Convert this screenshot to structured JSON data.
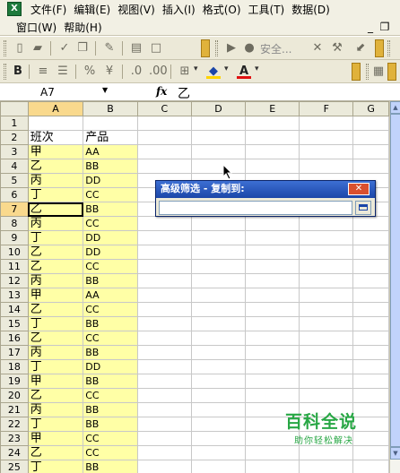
{
  "menu": {
    "row1": [
      "文件(F)",
      "编辑(E)",
      "视图(V)",
      "插入(I)",
      "格式(O)",
      "工具(T)",
      "数据(D)"
    ],
    "row2": [
      "窗口(W)",
      "帮助(H)"
    ],
    "minimize": "_",
    "restore": "❐"
  },
  "toolbar": {
    "security_label": "安全..."
  },
  "formula_bar": {
    "name_box": "A7",
    "fx": "fx",
    "value": "乙"
  },
  "grid": {
    "columns": [
      "A",
      "B",
      "C",
      "D",
      "E",
      "F",
      "G"
    ],
    "active_cell": "A7",
    "rows": [
      {
        "n": "1",
        "a": "",
        "b": ""
      },
      {
        "n": "2",
        "a": "班次",
        "b": "产品"
      },
      {
        "n": "3",
        "a": "甲",
        "b": "AA"
      },
      {
        "n": "4",
        "a": "乙",
        "b": "BB"
      },
      {
        "n": "5",
        "a": "丙",
        "b": "DD"
      },
      {
        "n": "6",
        "a": "丁",
        "b": "CC"
      },
      {
        "n": "7",
        "a": "乙",
        "b": "BB"
      },
      {
        "n": "8",
        "a": "丙",
        "b": "CC"
      },
      {
        "n": "9",
        "a": "丁",
        "b": "DD"
      },
      {
        "n": "10",
        "a": "乙",
        "b": "DD"
      },
      {
        "n": "11",
        "a": "乙",
        "b": "CC"
      },
      {
        "n": "12",
        "a": "丙",
        "b": "BB"
      },
      {
        "n": "13",
        "a": "甲",
        "b": "AA"
      },
      {
        "n": "14",
        "a": "乙",
        "b": "CC"
      },
      {
        "n": "15",
        "a": "丁",
        "b": "BB"
      },
      {
        "n": "16",
        "a": "乙",
        "b": "CC"
      },
      {
        "n": "17",
        "a": "丙",
        "b": "BB"
      },
      {
        "n": "18",
        "a": "丁",
        "b": "DD"
      },
      {
        "n": "19",
        "a": "甲",
        "b": "BB"
      },
      {
        "n": "20",
        "a": "乙",
        "b": "CC"
      },
      {
        "n": "21",
        "a": "丙",
        "b": "BB"
      },
      {
        "n": "22",
        "a": "丁",
        "b": "BB"
      },
      {
        "n": "23",
        "a": "甲",
        "b": "CC"
      },
      {
        "n": "24",
        "a": "乙",
        "b": "CC"
      },
      {
        "n": "25",
        "a": "丁",
        "b": "BB"
      }
    ]
  },
  "dialog": {
    "title": "高级筛选 - 复制到:",
    "close": "✕",
    "input_value": ""
  },
  "watermark": {
    "title": "百科全说",
    "subtitle": "助你轻松解决"
  },
  "colors": {
    "highlight": "#ffffa6",
    "dialog_title": "#1b46a8",
    "watermark": "#28a745"
  }
}
